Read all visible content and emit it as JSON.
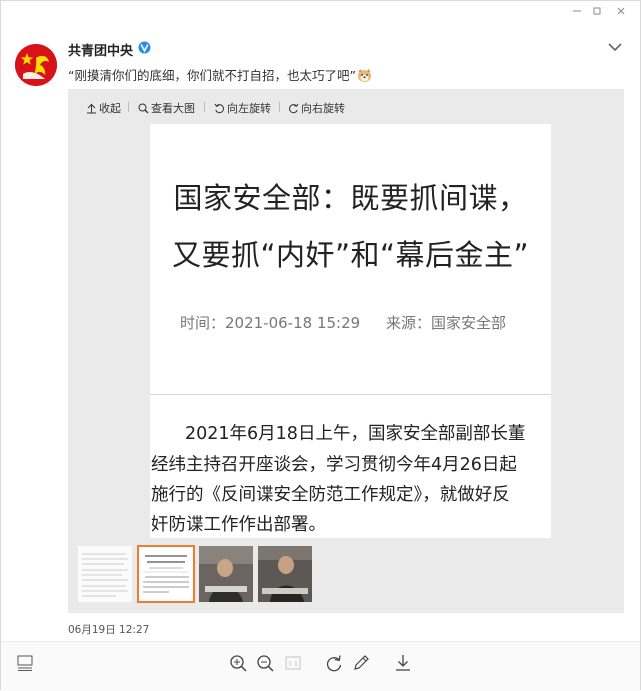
{
  "post": {
    "username": "共青团中央",
    "caption": "“刚摸清你们的底细，你们就不打自招，也太巧了吧”",
    "date": "06月19日 12:27"
  },
  "toolbar": {
    "collapse_label": "收起",
    "view_large_label": "查看大图",
    "rotate_left_label": "向左旋转",
    "rotate_right_label": "向右旋转"
  },
  "article": {
    "title_line1": "国家安全部：既要抓间谍，",
    "title_line2": "又要抓“内奸”和“幕后金主”",
    "time": "时间：2021-06-18 15:29",
    "source": "来源：国家安全部",
    "para_line1": "2021年6月18日上午，国家安全部副部长董",
    "para_line2": "经纬主持召开座谈会，学习贯彻今年4月26日起",
    "para_line3": "施行的《反间谍安全防范工作规定》，就做好反",
    "para_line4": "奸防谍工作作出部署。"
  },
  "thumbnails": {
    "count": 4,
    "active_index": 1
  },
  "icons": {
    "avatar": "flag-avatar-icon",
    "verified": "verified-badge-icon",
    "emoji": "doge-emoji-icon",
    "footer": [
      "layout-icon",
      "zoom-in-icon",
      "zoom-out-icon",
      "actual-size-icon",
      "rotate-icon",
      "edit-icon",
      "download-icon"
    ]
  },
  "colors": {
    "accent_orange": "#f07c2a",
    "flag_red": "#d9121a",
    "verified_blue": "#2b8de3"
  }
}
